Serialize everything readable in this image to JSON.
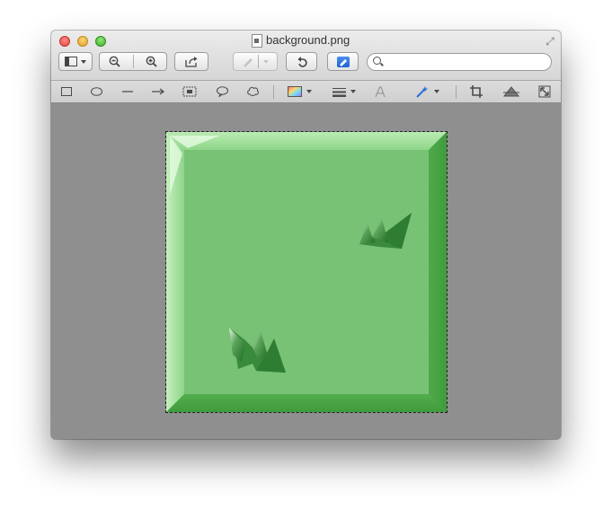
{
  "window": {
    "title": "background.png"
  },
  "toolbar": {
    "zoom_out_glyph": "⊖",
    "zoom_in_glyph": "⊕",
    "search_placeholder": "",
    "search_value": ""
  },
  "image": {
    "name": "background.png",
    "colors": {
      "face": "#78c276",
      "bevel_light": "#a8e3a1",
      "bevel_dark": "#3f9f3d",
      "grass_dark": "#2e7d32"
    }
  }
}
